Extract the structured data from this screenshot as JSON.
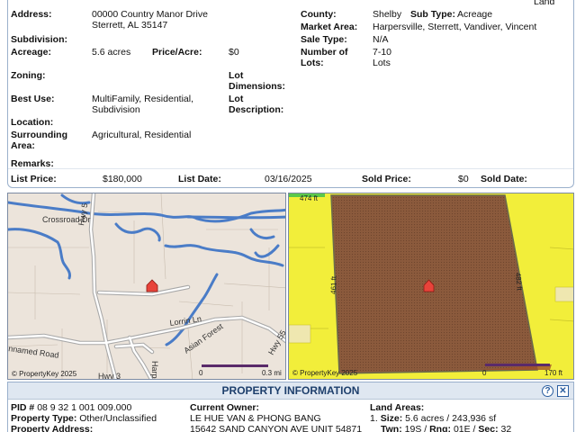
{
  "listing": {
    "top_right_label": "Land",
    "address_label": "Address:",
    "address_line1": "00000 Country Manor Drive",
    "address_line2": "Sterrett, AL 35147",
    "county_label": "County:",
    "county_value": "Shelby",
    "subtype_label": "Sub Type:",
    "subtype_value": "Acreage",
    "subdivision_label": "Subdivision:",
    "market_area_label": "Market Area:",
    "market_area_value": "Harpersville, Sterrett, Vandiver, Vincent",
    "sale_type_label": "Sale Type:",
    "sale_type_value": "N/A",
    "acreage_label": "Acreage:",
    "acreage_value": "5.6 acres",
    "price_acre_label": "Price/Acre:",
    "price_acre_value": "$0",
    "num_lots_label_1": "Number of",
    "num_lots_label_2": "Lots:",
    "num_lots_value_1": "7-10",
    "num_lots_value_2": "Lots",
    "zoning_label": "Zoning:",
    "lot_dim_label_1": "Lot",
    "lot_dim_label_2": "Dimensions:",
    "best_use_label": "Best Use:",
    "best_use_value_1": "MultiFamily, Residential,",
    "best_use_value_2": "Subdivision",
    "lot_desc_label_1": "Lot",
    "lot_desc_label_2": "Description:",
    "location_label": "Location:",
    "surrounding_label_1": "Surrounding",
    "surrounding_label_2": "Area:",
    "surrounding_value": "Agricultural, Residential",
    "remarks_label": "Remarks:",
    "list_price_label": "List Price:",
    "list_price_value": "$180,000",
    "list_date_label": "List Date:",
    "list_date_value": "03/16/2025",
    "sold_price_label": "Sold Price:",
    "sold_price_value": "$0",
    "sold_date_label": "Sold Date:"
  },
  "street_map": {
    "labels": {
      "crossroad": "Crossroad Dr",
      "hwy_top": "Hwy 5",
      "lorrin": "Lorrin Ln",
      "asian_forest": "Asian Forest",
      "unnamed": "nnamed Road",
      "hwy_right": "Hwy 55",
      "harpe": "Harpe St",
      "hwy_bottom": "Hwy 3"
    },
    "scale_start": "0",
    "scale_end": "0.3 mi",
    "credit": "© PropertyKey  2025"
  },
  "aerial_map": {
    "dim_top": "474 ft",
    "dim_left": "461 ft",
    "dim_right": "482 ft",
    "scale_start": "0",
    "scale_end": "170 ft",
    "credit": "© PropertyKey  2025",
    "colors": {
      "parcel": "#8b5a3c",
      "surrounding": "#f2ee3a"
    }
  },
  "property_info": {
    "title": "PROPERTY INFORMATION",
    "help_label": "?",
    "close_label": "✕",
    "pid_label": "PID #",
    "pid_value": "08 9 32 1 001 009.000",
    "property_type_label": "Property Type:",
    "property_type_value": "Other/Unclassified",
    "property_address_label": "Property Address:",
    "current_owner_label": "Current Owner:",
    "owner_line1": "LE HUE VAN & PHONG BANG",
    "owner_line2": "15642 SAND CANYON AVE UNIT 54871",
    "land_areas_label": "Land Areas:",
    "land_item_num": "1.",
    "size_label": "Size:",
    "size_value": "5.6 acres / 243,936 sf",
    "twn_label": "Twn:",
    "twn_value": "19S",
    "rng_label": "Rng:",
    "rng_value": "01E",
    "sec_label": "Sec:",
    "sec_value": "32"
  }
}
